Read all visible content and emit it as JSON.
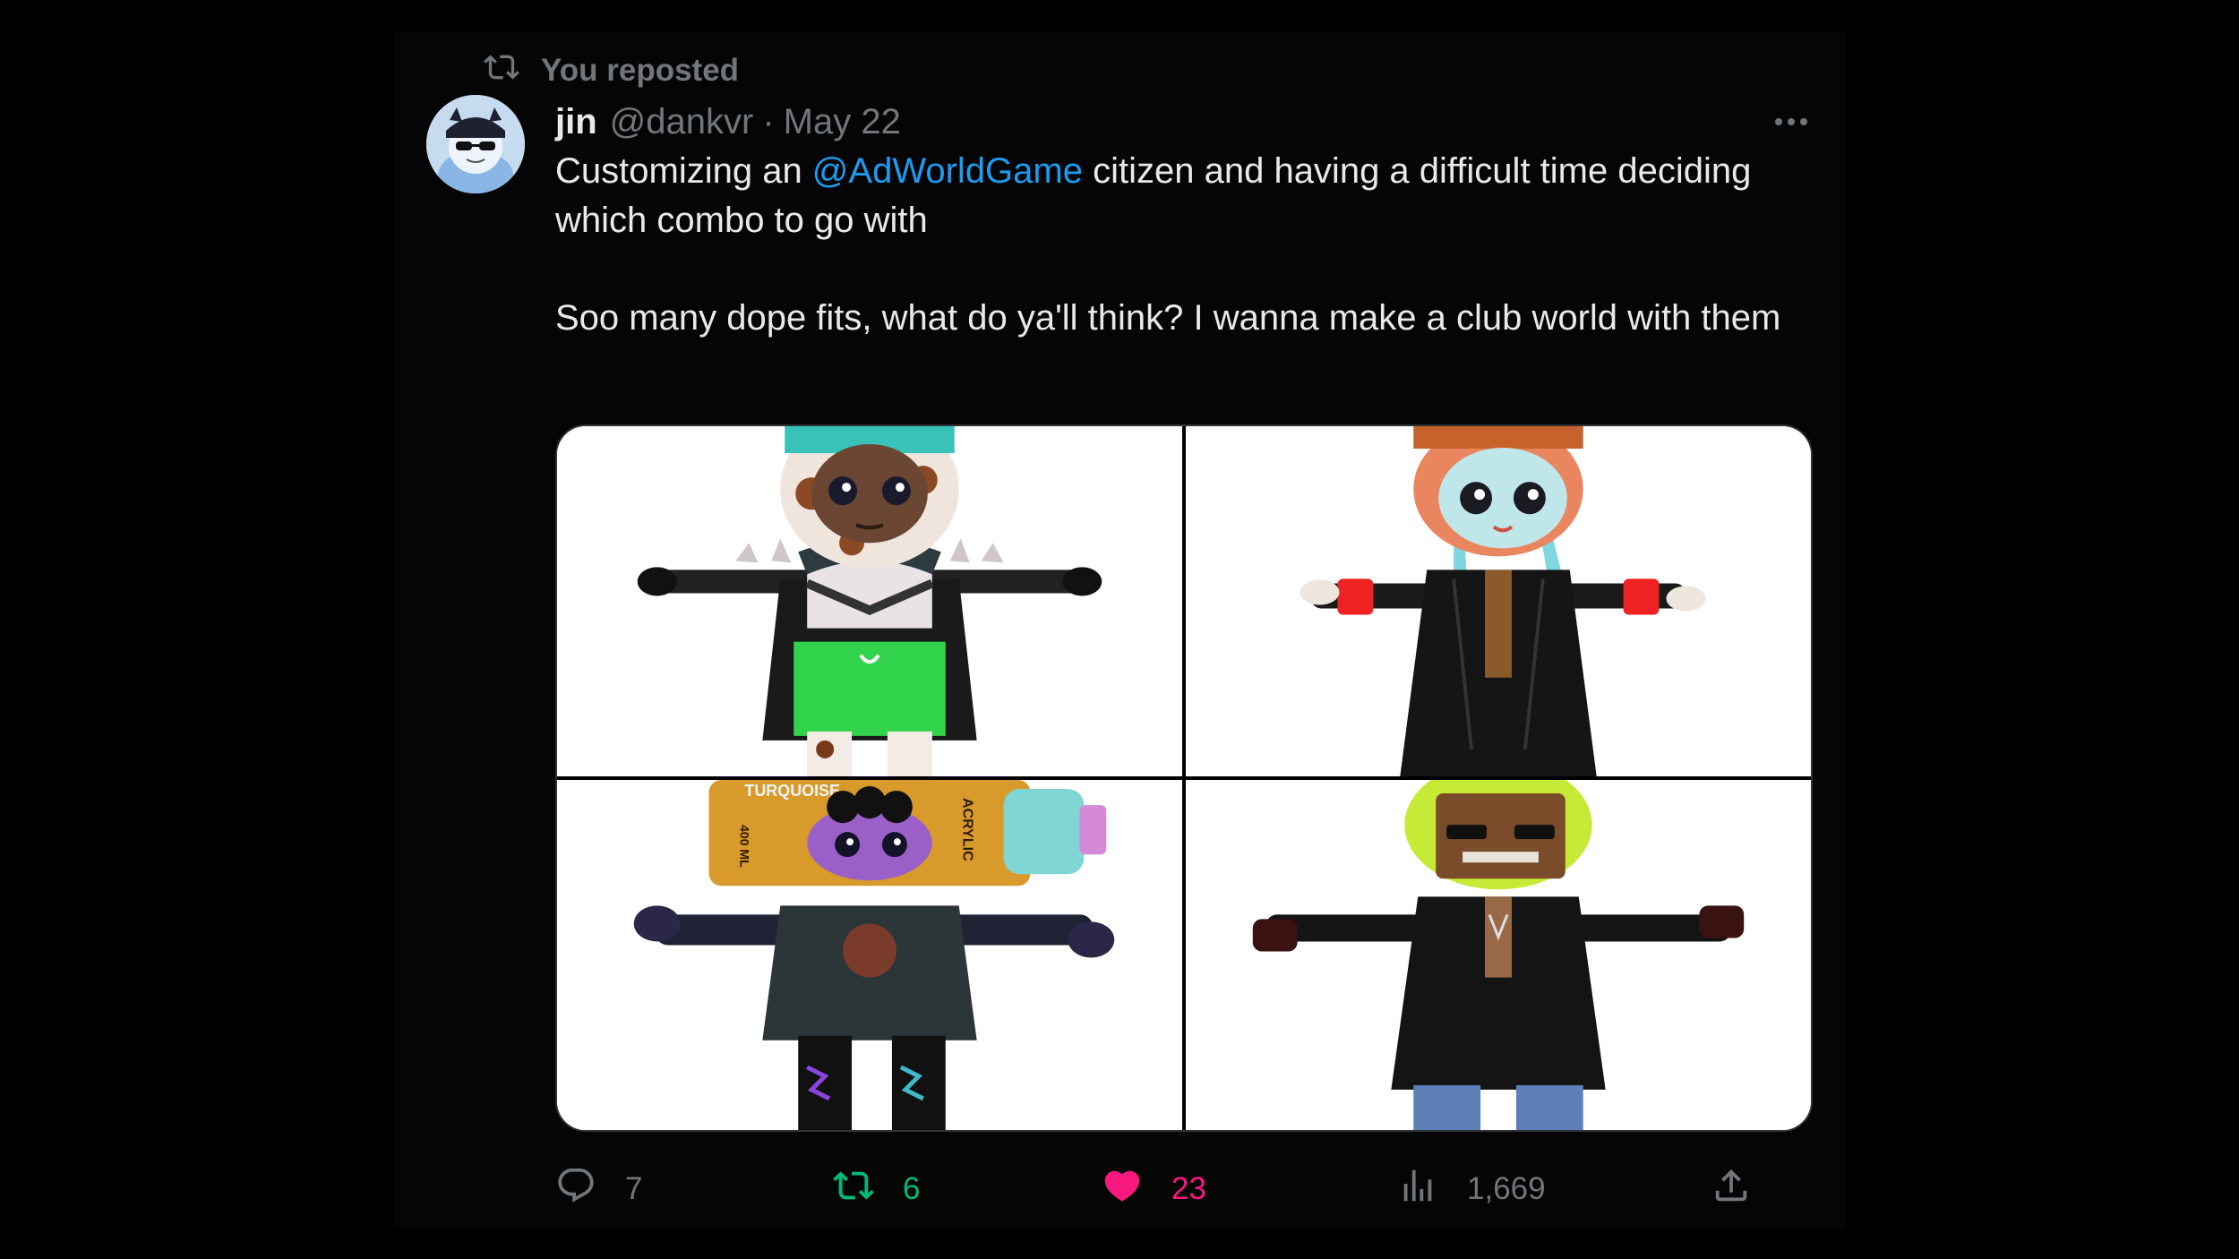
{
  "repost": {
    "label": "You reposted",
    "icon": "retweet-icon"
  },
  "author": {
    "display_name": "jin",
    "handle": "@dankvr",
    "separator": "·",
    "date": "May 22"
  },
  "tweet": {
    "text_before_mention": "Customizing an ",
    "mention": "@AdWorldGame",
    "text_after_mention": " citizen and having a difficult time deciding which combo to go with",
    "paragraph2": "Soo many dope fits, what do ya'll think? I wanna make a club world with them"
  },
  "media": {
    "images": [
      {
        "name": "avatar-outfit-1",
        "description_icon": "avatar-cow-print-hood"
      },
      {
        "name": "avatar-outfit-2",
        "description_icon": "avatar-burger-head"
      },
      {
        "name": "avatar-outfit-3",
        "label_top": "TURQUOISE",
        "label_side": "ACRYLIC",
        "label_volume": "400 ML"
      },
      {
        "name": "avatar-outfit-4",
        "description_icon": "avatar-green-hair"
      }
    ]
  },
  "actions": {
    "reply_count": "7",
    "retweet_count": "6",
    "like_count": "23",
    "view_count": "1,669"
  },
  "colors": {
    "accent": "#1d9bf0",
    "retweet": "#00ba7c",
    "like": "#f91880",
    "muted": "#71767b"
  }
}
